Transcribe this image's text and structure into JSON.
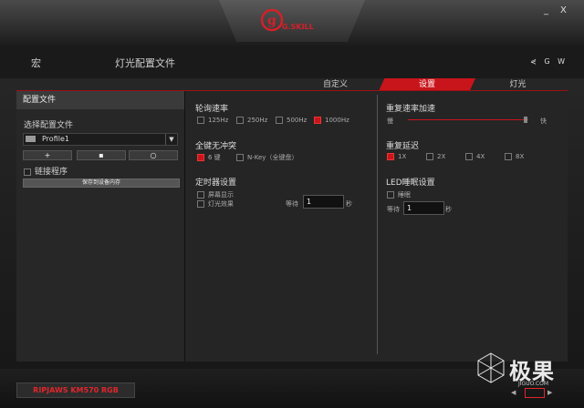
{
  "window": {
    "minimize": "_",
    "close": "X"
  },
  "nav": {
    "macro": "宏",
    "lighting": "灯光配置文件",
    "tools": "⋞ G W"
  },
  "tabs": [
    {
      "label": "自定义"
    },
    {
      "label": "设置"
    },
    {
      "label": "灯光"
    }
  ],
  "left": {
    "title": "配置文件",
    "select_label": "选择配置文件",
    "profile_value": "Profile1",
    "buttons": [
      "+",
      "▪",
      "○"
    ],
    "link_program": "链接程序",
    "save": "保存到设备内存"
  },
  "polling": {
    "title": "轮询速率",
    "options": [
      "125Hz",
      "250Hz",
      "500Hz",
      "1000Hz"
    ]
  },
  "nkro": {
    "title": "全键无冲突",
    "options": [
      "6 键",
      "N-Key（全键盘）"
    ]
  },
  "timer": {
    "title": "定时器设置",
    "opt1": "屏幕显示",
    "opt2": "灯光效果",
    "wait": "等待",
    "value": "1",
    "unit": "秒"
  },
  "repeat_rate": {
    "title": "重复速率加速",
    "slow": "慢",
    "fast": "快",
    "level": 0.96
  },
  "repeat_delay": {
    "title": "重复延迟",
    "options": [
      "1X",
      "2X",
      "4X",
      "8X"
    ]
  },
  "sleep": {
    "title": "LED睡眠设置",
    "opt": "睡眠",
    "wait": "等待",
    "value": "1",
    "unit": "秒"
  },
  "footer": {
    "model": "RIPJAWS KM570 RGB",
    "prev": "◀",
    "next": "▶"
  },
  "watermark": {
    "text": "极果",
    "sub": "JIGUO.COM"
  },
  "colors": {
    "accent": "#c8151b"
  }
}
